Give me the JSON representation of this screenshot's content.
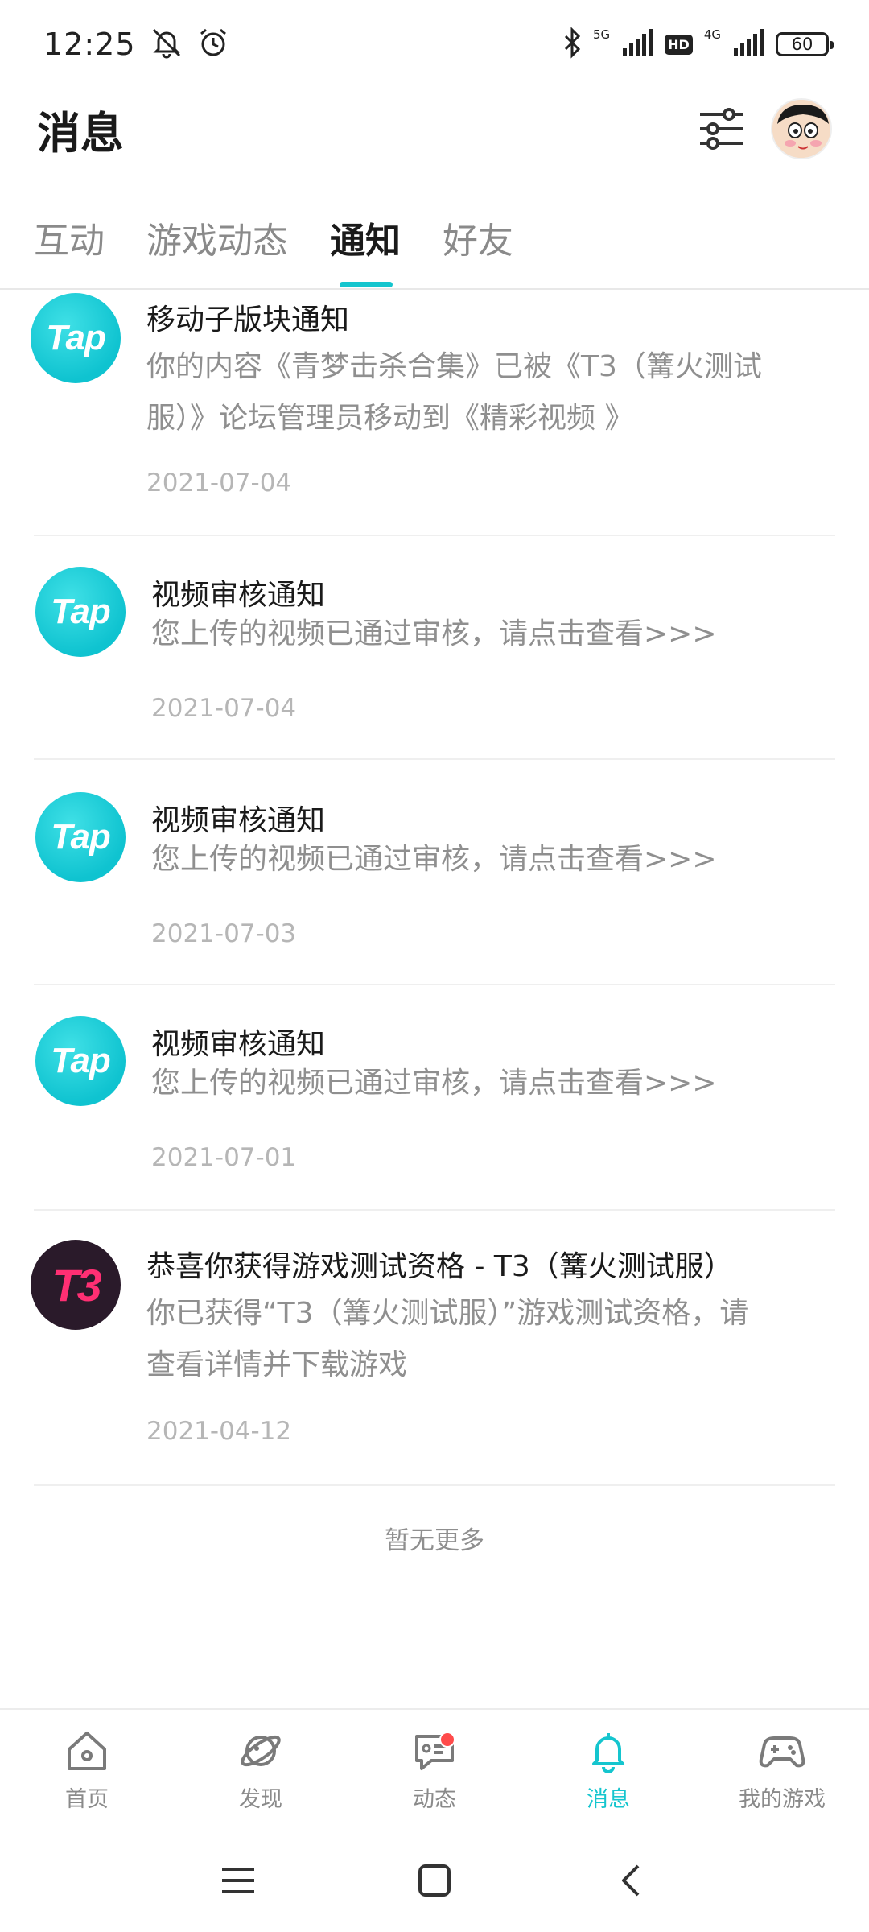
{
  "status_bar": {
    "time": "12:25",
    "net_5g": "5G",
    "hd": "HD",
    "net_4g": "4G",
    "battery": "60"
  },
  "header": {
    "title": "消息"
  },
  "tabs": [
    {
      "label": "互动",
      "active": false
    },
    {
      "label": "游戏动态",
      "active": false
    },
    {
      "label": "通知",
      "active": true
    },
    {
      "label": "好友",
      "active": false
    }
  ],
  "notifications": [
    {
      "logo": "Tap",
      "title": "移动子版块通知",
      "body_line1": "你的内容《青梦击杀合集》已被《T3（篝火测试",
      "body_line2": "服）》论坛管理员移动到《精彩视频 》",
      "date": "2021-07-04"
    },
    {
      "logo": "Tap",
      "title": "视频审核通知",
      "body_line1": "您上传的视频已通过审核，请点击查看>>>",
      "date": "2021-07-04"
    },
    {
      "logo": "Tap",
      "title": "视频审核通知",
      "body_line1": "您上传的视频已通过审核，请点击查看>>>",
      "date": "2021-07-03"
    },
    {
      "logo": "Tap",
      "title": "视频审核通知",
      "body_line1": "您上传的视频已通过审核，请点击查看>>>",
      "date": "2021-07-01"
    },
    {
      "logo": "T3",
      "title": "恭喜你获得游戏测试资格 - T3（篝火测试服）",
      "body_line1": "你已获得“T3（篝火测试服）”游戏测试资格，请",
      "body_line2": "查看详情并下载游戏",
      "date": "2021-04-12"
    }
  ],
  "footer": {
    "no_more": "暂无更多"
  },
  "bottom_nav": [
    {
      "label": "首页",
      "icon": "home-icon"
    },
    {
      "label": "发现",
      "icon": "planet-icon"
    },
    {
      "label": "动态",
      "icon": "chat-icon",
      "badge": true
    },
    {
      "label": "消息",
      "icon": "bell-icon",
      "active": true
    },
    {
      "label": "我的游戏",
      "icon": "gamepad-icon"
    }
  ],
  "colors": {
    "accent": "#15c5ce",
    "badge": "#ff4b4b",
    "t3_logo": "#ff2f73"
  }
}
